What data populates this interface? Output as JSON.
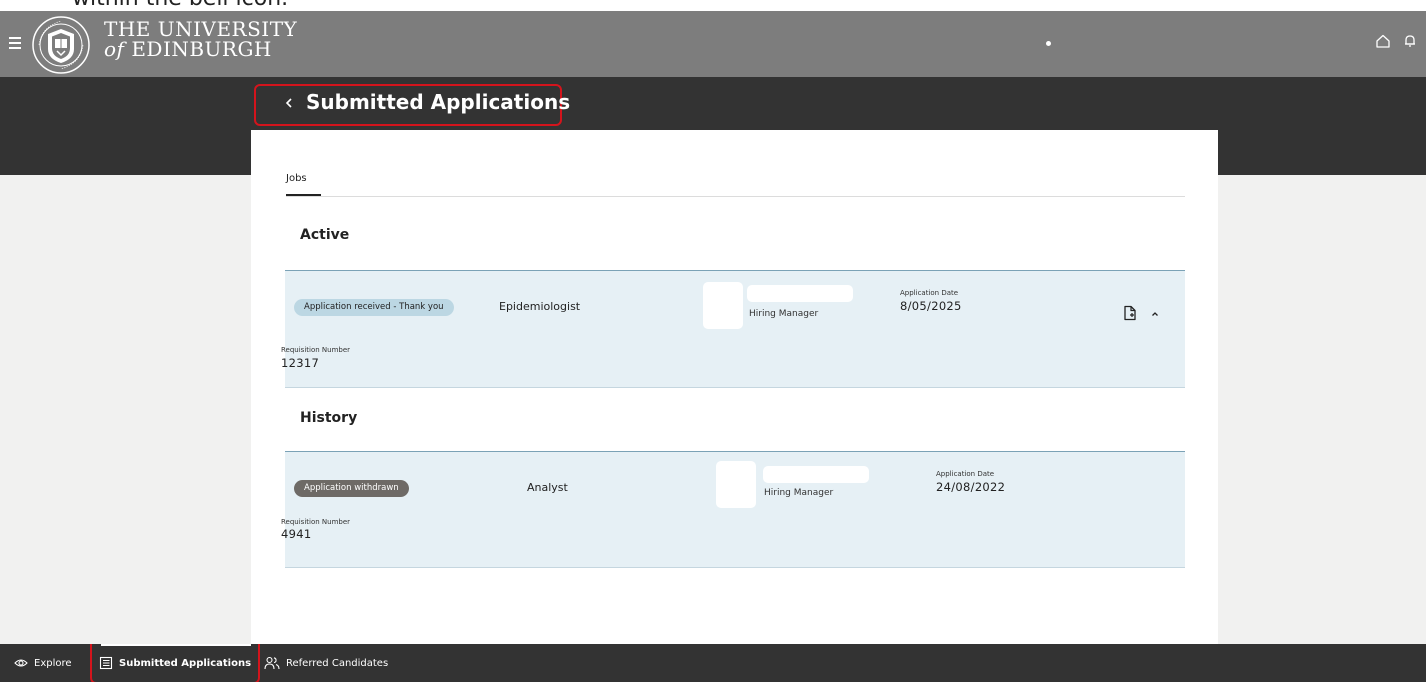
{
  "caption": "within the bell icon.",
  "header": {
    "brand_line1": "THE UNIVERSITY",
    "brand_of": "of",
    "brand_line2": "EDINBURGH",
    "icons": [
      "hamburger-menu-icon",
      "university-crest-icon",
      "home-icon",
      "bell-icon"
    ]
  },
  "page": {
    "title": "Submitted Applications"
  },
  "tabs": [
    {
      "label": "Jobs",
      "selected": true
    }
  ],
  "sections": {
    "active_title": "Active",
    "history_title": "History"
  },
  "applications": [
    {
      "status": "Application received - Thank you",
      "job_title": "Epidemiologist",
      "contact_role": "Hiring Manager",
      "date_label": "Application Date",
      "date_value": "8/05/2025",
      "req_label": "Requisition Number",
      "req_value": "12317"
    },
    {
      "status": "Application withdrawn",
      "job_title": "Analyst",
      "contact_role": "Hiring Manager",
      "date_label": "Application Date",
      "date_value": "24/08/2022",
      "req_label": "Requisition Number",
      "req_value": "4941"
    }
  ],
  "bottom_nav": [
    {
      "label": "Explore",
      "icon": "eye-icon"
    },
    {
      "label": "Submitted Applications",
      "icon": "list-icon",
      "selected": true
    },
    {
      "label": "Referred Candidates",
      "icon": "people-icon"
    }
  ],
  "colors": {
    "header_bg": "#7d7d7d",
    "dark_band": "#333333",
    "row_bg": "#e6f0f5",
    "highlight": "#d4141c",
    "pill_received": "#bcd7e3",
    "pill_withdrawn": "#6e6a66"
  }
}
